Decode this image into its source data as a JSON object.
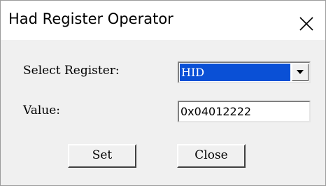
{
  "window": {
    "title": "Had Register Operator"
  },
  "form": {
    "register_label": "Select Register:",
    "register_selected": "HID",
    "value_label": "Value:",
    "value_text": "0x04012222"
  },
  "buttons": {
    "set_label": "Set",
    "close_label": "Close"
  },
  "icons": {
    "close": "close-icon",
    "dropdown": "chevron-down-icon"
  },
  "colors": {
    "selection": "#0a50d6",
    "dialog_bg": "#f0f0f0"
  }
}
